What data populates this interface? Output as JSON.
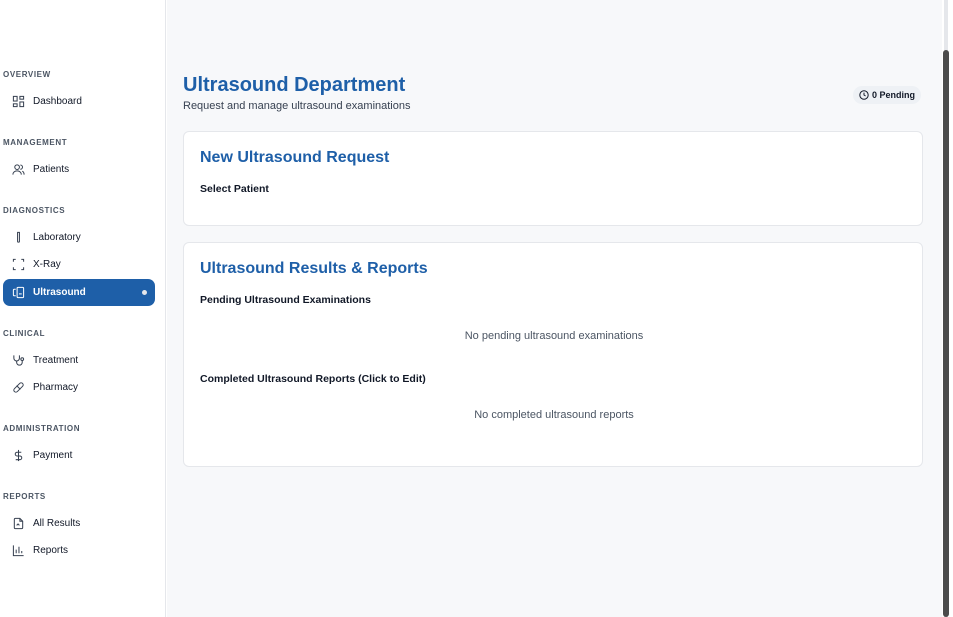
{
  "sidebar": {
    "sections": [
      {
        "label": "OVERVIEW",
        "items": [
          {
            "label": "Dashboard",
            "icon": "dashboard-icon"
          }
        ]
      },
      {
        "label": "MANAGEMENT",
        "items": [
          {
            "label": "Patients",
            "icon": "users-icon"
          }
        ]
      },
      {
        "label": "DIAGNOSTICS",
        "items": [
          {
            "label": "Laboratory",
            "icon": "test-tube-icon"
          },
          {
            "label": "X-Ray",
            "icon": "scan-icon"
          },
          {
            "label": "Ultrasound",
            "icon": "ultrasound-icon",
            "active": true
          }
        ]
      },
      {
        "label": "CLINICAL",
        "items": [
          {
            "label": "Treatment",
            "icon": "stethoscope-icon"
          },
          {
            "label": "Pharmacy",
            "icon": "pill-icon"
          }
        ]
      },
      {
        "label": "ADMINISTRATION",
        "items": [
          {
            "label": "Payment",
            "icon": "dollar-icon"
          }
        ]
      },
      {
        "label": "REPORTS",
        "items": [
          {
            "label": "All Results",
            "icon": "file-results-icon"
          },
          {
            "label": "Reports",
            "icon": "bar-chart-icon"
          }
        ]
      }
    ]
  },
  "header": {
    "title": "Ultrasound Department",
    "subtitle": "Request and manage ultrasound examinations",
    "pending_badge": "0 Pending"
  },
  "request_card": {
    "title": "New Ultrasound Request",
    "select_patient_label": "Select Patient"
  },
  "results_card": {
    "title": "Ultrasound Results & Reports",
    "pending_heading": "Pending Ultrasound Examinations",
    "pending_empty": "No pending ultrasound examinations",
    "completed_heading": "Completed Ultrasound Reports (Click to Edit)",
    "completed_empty": "No completed ultrasound reports"
  },
  "colors": {
    "accent": "#1e5fa8",
    "main_background": "#f7f8fa"
  }
}
